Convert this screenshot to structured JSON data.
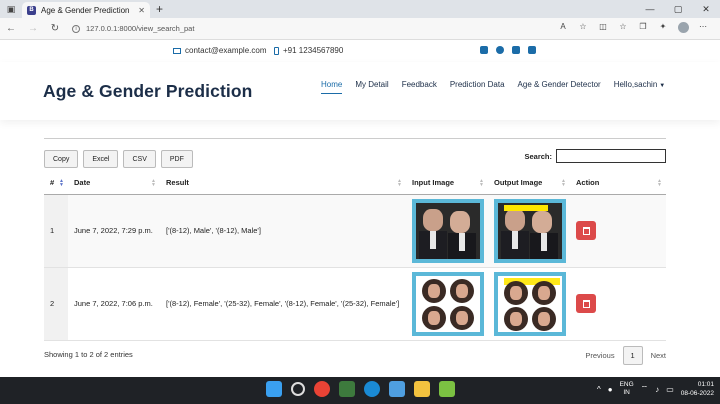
{
  "browser": {
    "tab_title": "Age & Gender Prediction",
    "tab_favicon": "B",
    "url": "127.0.0.1:8000/view_search_pat"
  },
  "topbar": {
    "email": "contact@example.com",
    "phone": "+91 1234567890"
  },
  "header": {
    "brand": "Age & Gender Prediction",
    "nav": [
      "Home",
      "My Detail",
      "Feedback",
      "Prediction Data",
      "Age & Gender Detector",
      "Hello,sachin"
    ]
  },
  "table_tools": {
    "buttons": [
      "Copy",
      "Excel",
      "CSV",
      "PDF"
    ],
    "search_label": "Search:",
    "search_value": ""
  },
  "table": {
    "columns": [
      "#",
      "Date",
      "Result",
      "Input Image",
      "Output Image",
      "Action"
    ],
    "rows": [
      {
        "num": "1",
        "date": "June 7, 2022, 7:29 p.m.",
        "result": "['(8-12), Male', '(8-12), Male']"
      },
      {
        "num": "2",
        "date": "June 7, 2022, 7:06 p.m.",
        "result": "['(8-12), Female', '(25-32), Female', '(8-12), Female', '(25-32), Female']"
      }
    ]
  },
  "footer": {
    "info": "Showing 1 to 2 of 2 entries",
    "previous": "Previous",
    "current_page": "1",
    "next": "Next"
  },
  "taskbar": {
    "lang_line1": "ENG",
    "lang_line2": "IN",
    "time": "01:01",
    "date": "08-06-2022"
  },
  "colors": {
    "accent": "#1b6ca8",
    "brand": "#1c2e48",
    "delete": "#dc4a4a",
    "image_frame": "#5bb8d8"
  }
}
